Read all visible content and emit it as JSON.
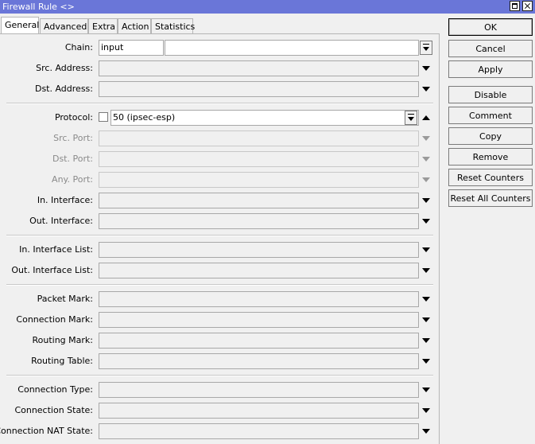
{
  "window": {
    "title": "Firewall Rule <>"
  },
  "tabs": [
    "General",
    "Advanced",
    "Extra",
    "Action",
    "Statistics"
  ],
  "fields": {
    "chain": {
      "label": "Chain:",
      "value": "input"
    },
    "src_address": {
      "label": "Src. Address:"
    },
    "dst_address": {
      "label": "Dst. Address:"
    },
    "protocol": {
      "label": "Protocol:",
      "value": "50 (ipsec-esp)"
    },
    "src_port": {
      "label": "Src. Port:"
    },
    "dst_port": {
      "label": "Dst. Port:"
    },
    "any_port": {
      "label": "Any. Port:"
    },
    "in_interface": {
      "label": "In. Interface:"
    },
    "out_interface": {
      "label": "Out. Interface:"
    },
    "in_interface_list": {
      "label": "In. Interface List:"
    },
    "out_interface_list": {
      "label": "Out. Interface List:"
    },
    "packet_mark": {
      "label": "Packet Mark:"
    },
    "connection_mark": {
      "label": "Connection Mark:"
    },
    "routing_mark": {
      "label": "Routing Mark:"
    },
    "routing_table": {
      "label": "Routing Table:"
    },
    "connection_type": {
      "label": "Connection Type:"
    },
    "connection_state": {
      "label": "Connection State:"
    },
    "connection_nat_state": {
      "label": "Connection NAT State:"
    }
  },
  "buttons": {
    "ok": "OK",
    "cancel": "Cancel",
    "apply": "Apply",
    "disable": "Disable",
    "comment": "Comment",
    "copy": "Copy",
    "remove": "Remove",
    "reset_counters": "Reset Counters",
    "reset_all_counters": "Reset All Counters"
  }
}
